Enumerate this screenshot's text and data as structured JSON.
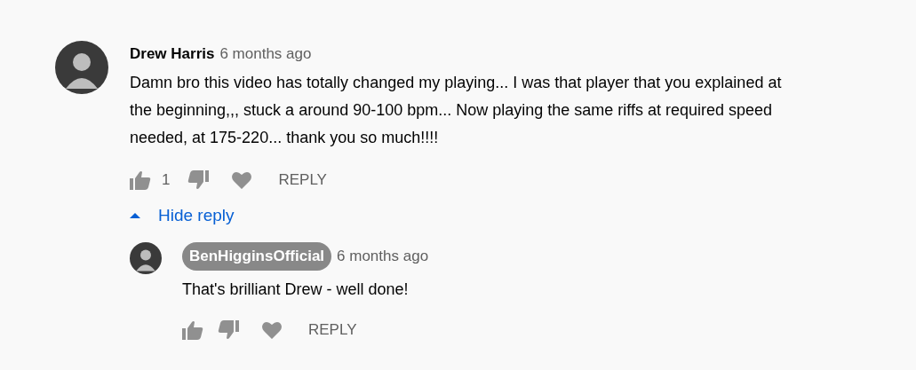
{
  "comment": {
    "author": "Drew Harris",
    "owner": false,
    "time": "6 months ago",
    "text": "Damn bro this video has totally changed my playing... I was that player that you explained at the beginning,,, stuck a around 90-100 bpm... Now playing the same riffs at required speed needed, at 175-220... thank you so much!!!!",
    "likes": "1",
    "reply_button": "REPLY",
    "replies_toggle": {
      "label": "Hide reply",
      "expanded": true
    },
    "replies": [
      {
        "author": "BenHigginsOfficial",
        "owner": true,
        "time": "6 months ago",
        "text": "That's brilliant Drew - well done!",
        "reply_button": "REPLY"
      }
    ]
  }
}
